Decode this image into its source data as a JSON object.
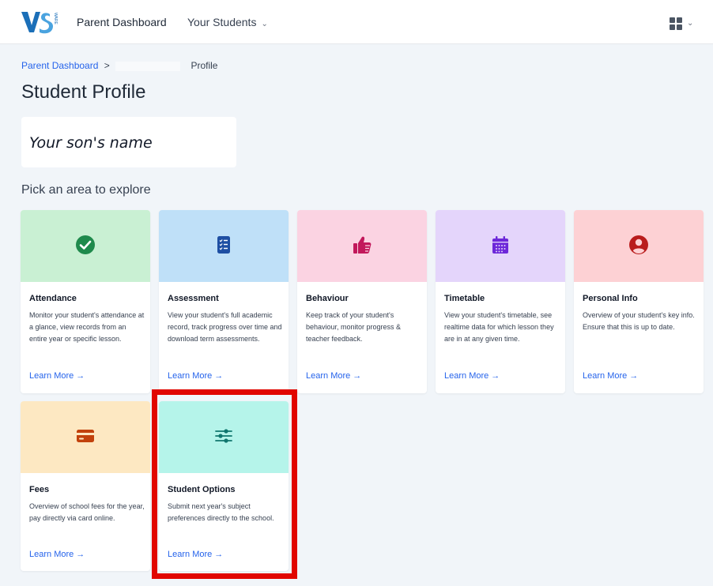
{
  "header": {
    "logo_text": "VS",
    "logo_sub": "WARE",
    "nav": {
      "dashboard": "Parent Dashboard",
      "students": "Your Students"
    }
  },
  "breadcrumb": {
    "parent": "Parent Dashboard",
    "separator": ">",
    "current": "Profile"
  },
  "page": {
    "title": "Student Profile",
    "student_name": "Your son's name",
    "section_heading": "Pick an area to explore"
  },
  "colors": {
    "attendance_bg": "#c9f0d3",
    "assessment_bg": "#bfe0f8",
    "behaviour_bg": "#fbd3e2",
    "timetable_bg": "#e4d5fb",
    "personal_bg": "#fdd1d4",
    "fees_bg": "#fde8c2",
    "options_bg": "#b5f4ea",
    "highlight": "#e10600",
    "link": "#2563eb"
  },
  "cards": [
    {
      "id": "attendance",
      "title": "Attendance",
      "description": "Monitor your student's attendance at a glance, view records from an entire year or specific lesson.",
      "link": "Learn More →",
      "icon": "check-circle-icon"
    },
    {
      "id": "assessment",
      "title": "Assessment",
      "description": "View your student's full academic record, track progress over time and download term assessments.",
      "link": "Learn More →",
      "icon": "clipboard-list-icon"
    },
    {
      "id": "behaviour",
      "title": "Behaviour",
      "description": "Keep track of your student's behaviour, monitor progress & teacher feedback.",
      "link": "Learn More →",
      "icon": "thumbs-up-icon"
    },
    {
      "id": "timetable",
      "title": "Timetable",
      "description": "View your student's timetable, see realtime data for which lesson they are in at any given time.",
      "link": "Learn More →",
      "icon": "calendar-icon"
    },
    {
      "id": "personal-info",
      "title": "Personal Info",
      "description": "Overview of your student's key info. Ensure that this is up to date.",
      "link": "Learn More →",
      "icon": "user-circle-icon"
    },
    {
      "id": "fees",
      "title": "Fees",
      "description": "Overview of school fees for the year, pay directly via card online.",
      "link": "Learn More →",
      "icon": "credit-card-icon"
    },
    {
      "id": "student-options",
      "title": "Student Options",
      "description": "Submit next year's subject preferences directly to the school.",
      "link": "Learn More →",
      "icon": "sliders-icon"
    }
  ]
}
